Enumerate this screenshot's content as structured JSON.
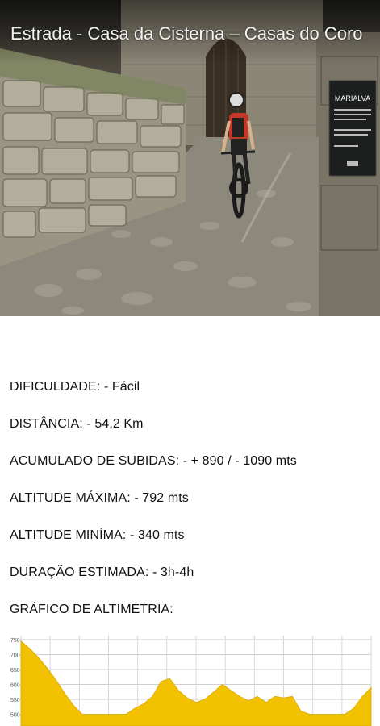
{
  "header": {
    "title": "Estrada - Casa da Cisterna – Casas do Coro"
  },
  "photo": {
    "sign_title": "MARIALVA"
  },
  "route_info": [
    {
      "label": "DIFICULDADE:",
      "value": "- Fácil"
    },
    {
      "label": "DISTÂNCIA:",
      "value": "- 54,2 Km"
    },
    {
      "label": "ACUMULADO DE SUBIDAS:",
      "value": "- + 890 / - 1090 mts"
    },
    {
      "label": "ALTITUDE MÁXIMA:",
      "value": "- 792 mts"
    },
    {
      "label": "ALTITUDE MINÍMA:",
      "value": "- 340 mts"
    },
    {
      "label": "DURAÇÃO ESTIMADA:",
      "value": "- 3h-4h"
    },
    {
      "label": "GRÁFICO DE ALTIMETRIA:",
      "value": ""
    }
  ],
  "altimetry": {
    "fill_color": "#f2c200",
    "chart_data": {
      "type": "area",
      "title": "",
      "ylim": [
        500,
        750
      ],
      "y_ticks": [
        "750",
        "700",
        "650",
        "600",
        "550",
        "500"
      ],
      "grid": true,
      "x": [
        0,
        1,
        2,
        3,
        4,
        5,
        6,
        7,
        8,
        9,
        10,
        11,
        12,
        13,
        14,
        15,
        16,
        17,
        18,
        19,
        20,
        21,
        22,
        23,
        24,
        25,
        26,
        27,
        28,
        29,
        30,
        31,
        32,
        33,
        34,
        35,
        36,
        37,
        38,
        39,
        40
      ],
      "values": [
        745,
        720,
        690,
        655,
        615,
        570,
        530,
        500,
        500,
        500,
        500,
        500,
        500,
        520,
        535,
        560,
        610,
        620,
        580,
        555,
        540,
        550,
        575,
        600,
        580,
        560,
        545,
        560,
        540,
        560,
        555,
        560,
        510,
        500,
        500,
        500,
        500,
        500,
        520,
        560,
        590
      ]
    }
  }
}
